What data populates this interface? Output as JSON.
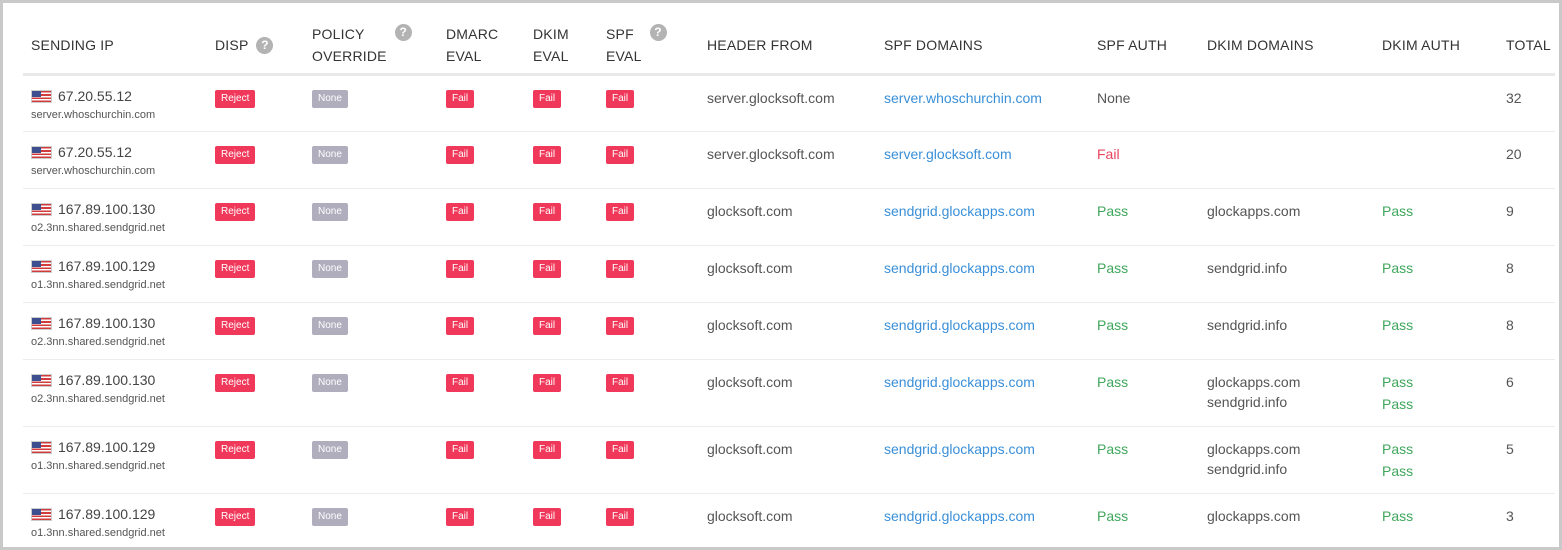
{
  "headers": {
    "sending_ip": "SENDING IP",
    "disp": "DISP",
    "policy_override_line1": "POLICY",
    "policy_override_line2": "OVERRIDE",
    "dmarc_eval_line1": "DMARC",
    "dmarc_eval_line2": "EVAL",
    "dkim_eval_line1": "DKIM",
    "dkim_eval_line2": "EVAL",
    "spf_eval_line1": "SPF",
    "spf_eval_line2": "EVAL",
    "header_from": "HEADER FROM",
    "spf_domains": "SPF DOMAINS",
    "spf_auth": "SPF AUTH",
    "dkim_domains": "DKIM DOMAINS",
    "dkim_auth": "DKIM AUTH",
    "total": "TOTAL",
    "help_glyph": "?"
  },
  "icons": {
    "flag": "us-flag-icon",
    "help": "question-mark-icon"
  },
  "colors": {
    "reject": "#f0395a",
    "none_badge": "#b0aebd",
    "link": "#3a8fd8",
    "pass": "#3fa65c",
    "fail": "#e8455d"
  },
  "rows": [
    {
      "ip": "67.20.55.12",
      "host": "server.whoschurchin.com",
      "disp": "Reject",
      "policy": "None",
      "dmarc": "Fail",
      "dkim": "Fail",
      "spf": "Fail",
      "header_from": "server.glocksoft.com",
      "spf_domain": "server.whoschurchin.com",
      "spf_auth": "None",
      "dkim_domains": [],
      "dkim_auth": [],
      "total": "32"
    },
    {
      "ip": "67.20.55.12",
      "host": "server.whoschurchin.com",
      "disp": "Reject",
      "policy": "None",
      "dmarc": "Fail",
      "dkim": "Fail",
      "spf": "Fail",
      "header_from": "server.glocksoft.com",
      "spf_domain": "server.glocksoft.com",
      "spf_auth": "Fail",
      "dkim_domains": [],
      "dkim_auth": [],
      "total": "20"
    },
    {
      "ip": "167.89.100.130",
      "host": "o2.3nn.shared.sendgrid.net",
      "disp": "Reject",
      "policy": "None",
      "dmarc": "Fail",
      "dkim": "Fail",
      "spf": "Fail",
      "header_from": "glocksoft.com",
      "spf_domain": "sendgrid.glockapps.com",
      "spf_auth": "Pass",
      "dkim_domains": [
        "glockapps.com"
      ],
      "dkim_auth": [
        "Pass"
      ],
      "total": "9"
    },
    {
      "ip": "167.89.100.129",
      "host": "o1.3nn.shared.sendgrid.net",
      "disp": "Reject",
      "policy": "None",
      "dmarc": "Fail",
      "dkim": "Fail",
      "spf": "Fail",
      "header_from": "glocksoft.com",
      "spf_domain": "sendgrid.glockapps.com",
      "spf_auth": "Pass",
      "dkim_domains": [
        "sendgrid.info"
      ],
      "dkim_auth": [
        "Pass"
      ],
      "total": "8"
    },
    {
      "ip": "167.89.100.130",
      "host": "o2.3nn.shared.sendgrid.net",
      "disp": "Reject",
      "policy": "None",
      "dmarc": "Fail",
      "dkim": "Fail",
      "spf": "Fail",
      "header_from": "glocksoft.com",
      "spf_domain": "sendgrid.glockapps.com",
      "spf_auth": "Pass",
      "dkim_domains": [
        "sendgrid.info"
      ],
      "dkim_auth": [
        "Pass"
      ],
      "total": "8"
    },
    {
      "ip": "167.89.100.130",
      "host": "o2.3nn.shared.sendgrid.net",
      "disp": "Reject",
      "policy": "None",
      "dmarc": "Fail",
      "dkim": "Fail",
      "spf": "Fail",
      "header_from": "glocksoft.com",
      "spf_domain": "sendgrid.glockapps.com",
      "spf_auth": "Pass",
      "dkim_domains": [
        "glockapps.com",
        "sendgrid.info"
      ],
      "dkim_auth": [
        "Pass",
        "Pass"
      ],
      "total": "6"
    },
    {
      "ip": "167.89.100.129",
      "host": "o1.3nn.shared.sendgrid.net",
      "disp": "Reject",
      "policy": "None",
      "dmarc": "Fail",
      "dkim": "Fail",
      "spf": "Fail",
      "header_from": "glocksoft.com",
      "spf_domain": "sendgrid.glockapps.com",
      "spf_auth": "Pass",
      "dkim_domains": [
        "glockapps.com",
        "sendgrid.info"
      ],
      "dkim_auth": [
        "Pass",
        "Pass"
      ],
      "total": "5"
    },
    {
      "ip": "167.89.100.129",
      "host": "o1.3nn.shared.sendgrid.net",
      "disp": "Reject",
      "policy": "None",
      "dmarc": "Fail",
      "dkim": "Fail",
      "spf": "Fail",
      "header_from": "glocksoft.com",
      "spf_domain": "sendgrid.glockapps.com",
      "spf_auth": "Pass",
      "dkim_domains": [
        "glockapps.com"
      ],
      "dkim_auth": [
        "Pass"
      ],
      "total": "3"
    }
  ]
}
